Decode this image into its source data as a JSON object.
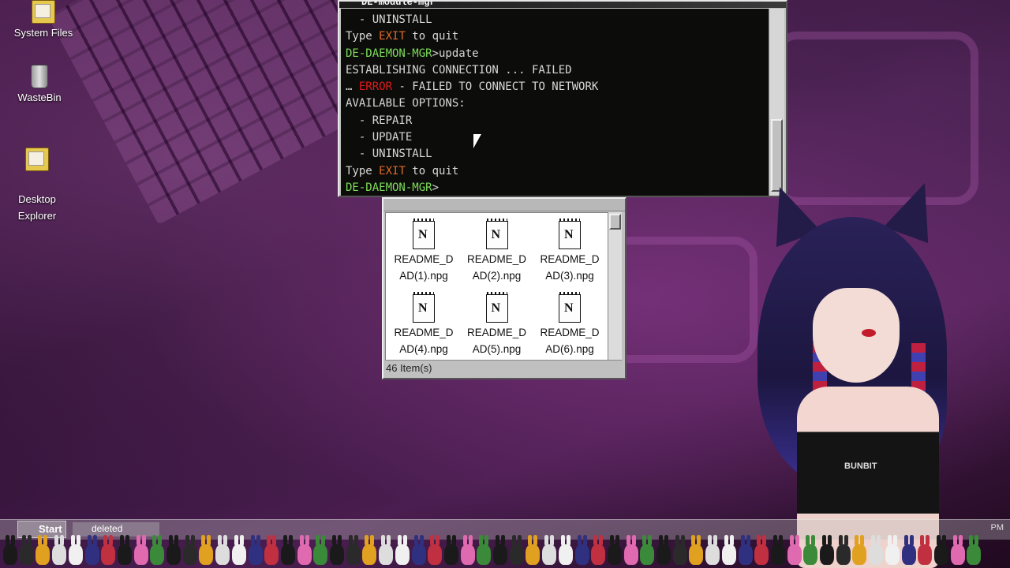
{
  "desktop": {
    "icons": [
      {
        "label": "System Files",
        "icon": "folder-icon"
      },
      {
        "label": "WasteBin",
        "icon": "trash-bin-icon"
      },
      {
        "label": "Desktop\nExplorer",
        "icon": "folder-icon"
      }
    ]
  },
  "terminal": {
    "title": "DE-module-mgr",
    "prompt": "DE-DAEMON-MGR",
    "lines": [
      {
        "text": "  - UNINSTALL"
      },
      {
        "pre": "Type ",
        "accent": "EXIT",
        "post": " to quit"
      },
      {
        "prompt": "DE-DAEMON-MGR",
        "cmd": "update"
      },
      {
        "text": "ESTABLISHING CONNECTION ... FAILED"
      },
      {
        "pre": "… ",
        "error": "ERROR",
        "post": " - FAILED TO CONNECT TO NETWORK"
      },
      {
        "text": "AVAILABLE OPTIONS:"
      },
      {
        "text": "  - REPAIR"
      },
      {
        "text": "  - UPDATE"
      },
      {
        "text": "  - UNINSTALL"
      },
      {
        "pre": "Type ",
        "accent": "EXIT",
        "post": " to quit"
      },
      {
        "prompt": "DE-DAEMON-MGR",
        "cmd": ""
      }
    ]
  },
  "explorer": {
    "files": [
      "README_D\nAD(1).npg",
      "README_D\nAD(2).npg",
      "README_D\nAD(3).npg",
      "README_D\nAD(4).npg",
      "README_D\nAD(5).npg",
      "README_D\nAD(6).npg"
    ],
    "status": "46 Item(s)"
  },
  "taskbar": {
    "start_label": "Start",
    "task_label": "deleted",
    "clock": "PM"
  },
  "avatar": {
    "shirt_text": "BUNBIT"
  },
  "colors": {
    "prompt_green": "#7ddc5a",
    "exit_orange": "#e06a2a",
    "error_red": "#e01a1a",
    "terminal_bg": "#0c0c0a",
    "window_gray": "#c0c0c0"
  }
}
